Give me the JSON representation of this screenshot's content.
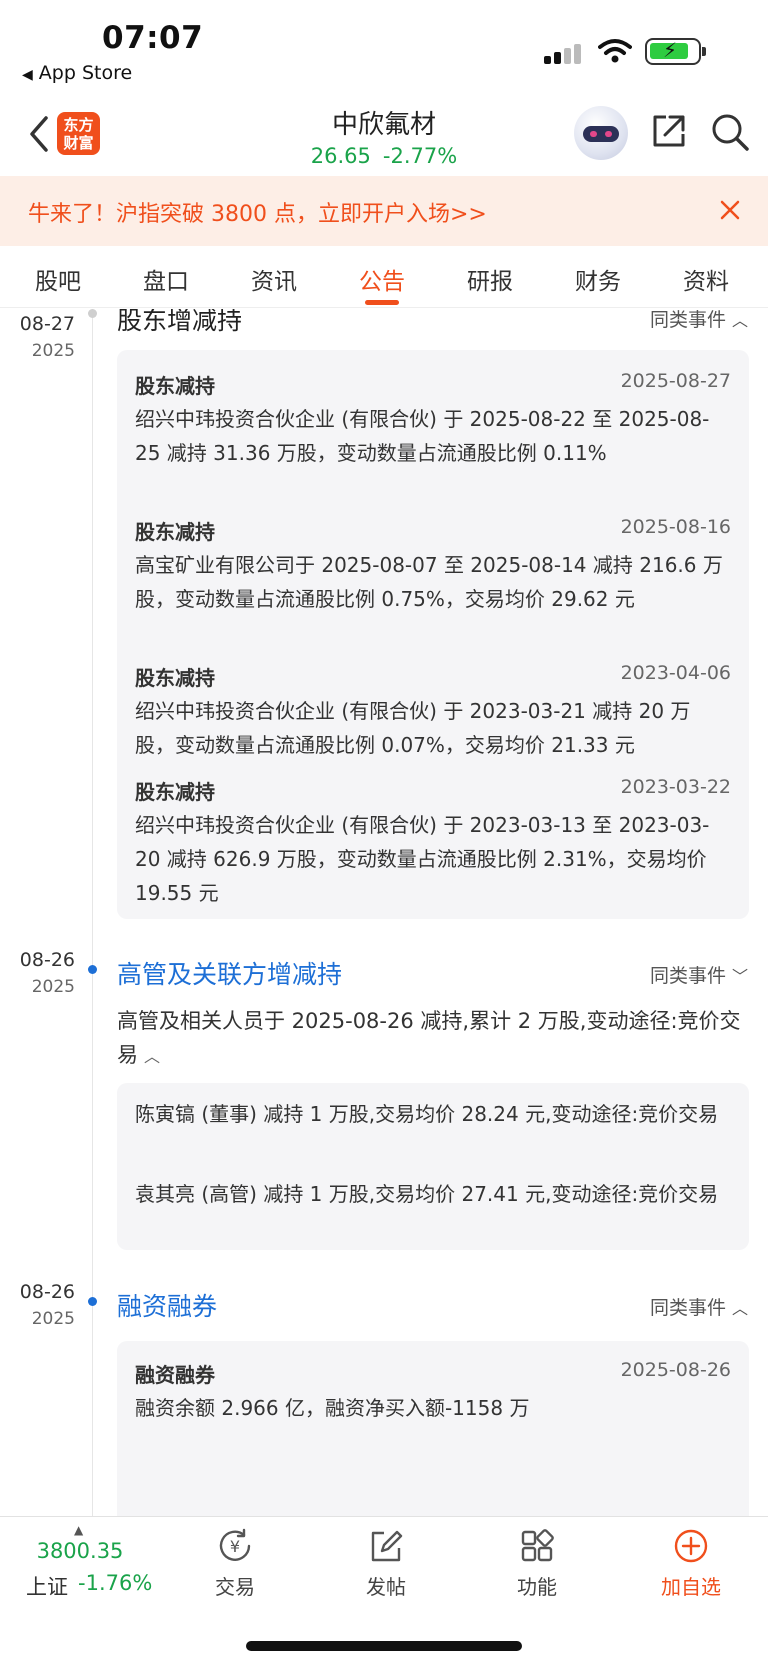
{
  "status_bar": {
    "time": "07:07",
    "back_app": "App Store"
  },
  "header": {
    "logo_line1": "东方",
    "logo_line2": "财富",
    "stock_name": "中欣氟材",
    "price": "26.65",
    "change_pct": "-2.77%"
  },
  "banner": {
    "text": "牛来了！沪指突破 3800 点，立即开户入场>>"
  },
  "tabs": [
    {
      "label": "股吧"
    },
    {
      "label": "盘口"
    },
    {
      "label": "资讯"
    },
    {
      "label": "公告"
    },
    {
      "label": "研报"
    },
    {
      "label": "财务"
    },
    {
      "label": "资料"
    }
  ],
  "active_tab": "公告",
  "events": [
    {
      "md": "08-27",
      "year": "2025",
      "title": "股东增减持",
      "same_label": "同类事件",
      "items": [
        {
          "title": "股东减持",
          "date": "2025-08-27",
          "body": "绍兴中玮投资合伙企业 (有限合伙) 于 2025-08-22 至 2025-08-25 减持 31.36 万股，变动数量占流通股比例 0.11%"
        },
        {
          "title": "股东减持",
          "date": "2025-08-16",
          "body": "高宝矿业有限公司于 2025-08-07 至 2025-08-14 减持 216.6 万股，变动数量占流通股比例 0.75%，交易均价 29.62 元"
        },
        {
          "title": "股东减持",
          "date": "2023-04-06",
          "body": "绍兴中玮投资合伙企业 (有限合伙) 于 2023-03-21 减持 20 万股，变动数量占流通股比例 0.07%，交易均价 21.33 元"
        },
        {
          "title": "股东减持",
          "date": "2023-03-22",
          "body": "绍兴中玮投资合伙企业 (有限合伙) 于 2023-03-13 至 2023-03-20 减持 626.9 万股，变动数量占流通股比例 2.31%，交易均价 19.55 元"
        }
      ]
    },
    {
      "md": "08-26",
      "year": "2025",
      "title": "高管及关联方增减持",
      "same_label": "同类事件",
      "desc": "高管及相关人员于 2025-08-26 减持,累计 2 万股,变动途径:竞价交易",
      "items": [
        {
          "body": "陈寅镐 (董事) 减持 1 万股,交易均价 28.24 元,变动途径:竞价交易"
        },
        {
          "body": "袁其亮 (高管) 减持 1 万股,交易均价 27.41 元,变动途径:竞价交易"
        }
      ]
    },
    {
      "md": "08-26",
      "year": "2025",
      "title": "融资融券",
      "same_label": "同类事件",
      "items": [
        {
          "title": "融资融券",
          "date": "2025-08-26",
          "body": "融资余额 2.966 亿，融资净买入额-1158 万"
        }
      ]
    }
  ],
  "bottom_bar": {
    "index_value": "3800.35",
    "index_name": "上证",
    "index_pct": "-1.76%",
    "items": [
      {
        "label": "交易",
        "icon": "yuan-exchange-icon"
      },
      {
        "label": "发帖",
        "icon": "edit-icon"
      },
      {
        "label": "功能",
        "icon": "grid-icon"
      },
      {
        "label": "加自选",
        "icon": "add-circle-icon"
      }
    ]
  },
  "colors": {
    "accent": "#f04f1c",
    "down_green": "#1aa34a",
    "link_blue": "#1d6fd6"
  }
}
